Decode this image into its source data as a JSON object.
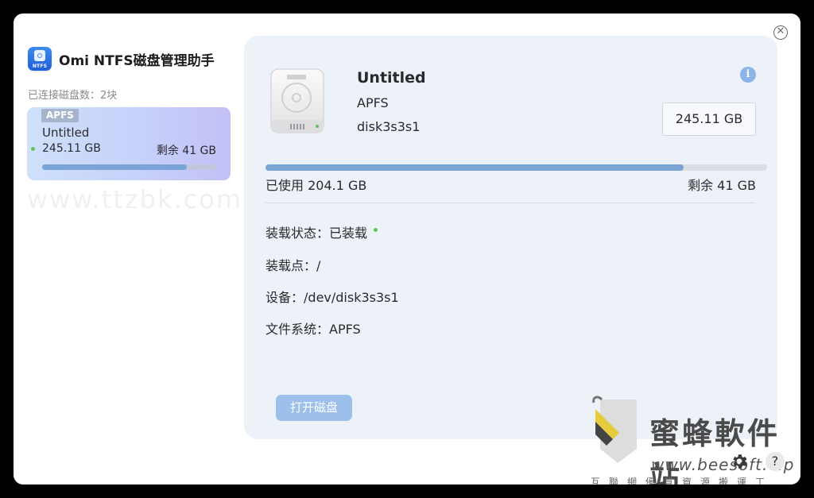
{
  "app": {
    "title": "Omi NTFS磁盘管理助手",
    "logo_text": "NTFS"
  },
  "sidebar": {
    "disk_count_label": "已连接磁盘数：2块",
    "disks": [
      {
        "fs_tag": "APFS",
        "name": "Untitled",
        "size": "245.11 GB",
        "free": "剩余 41 GB",
        "used_fraction": 0.833,
        "status_color": "#5dc65b"
      }
    ],
    "watermark": "www.ttzbk.com"
  },
  "detail": {
    "name": "Untitled",
    "fs": "APFS",
    "device_id": "disk3s3s1",
    "capacity": "245.11 GB",
    "used_label": "已使用 204.1 GB",
    "free_label": "剩余 41 GB",
    "used_fraction": 0.833,
    "properties": {
      "mount_status_label": "装载状态：",
      "mount_status_value": "已装载",
      "mount_point_label": "装载点：",
      "mount_point_value": "/",
      "device_label": "设备：",
      "device_value": "/dev/disk3s3s1",
      "filesystem_label": "文件系统：",
      "filesystem_value": "APFS"
    },
    "open_button": "打开磁盘"
  },
  "icons": {
    "close": "close-icon",
    "info": "info-icon",
    "settings": "gear-icon",
    "help": "help-icon",
    "help_glyph": "?"
  },
  "brand_watermark": {
    "title": "蜜蜂軟件站",
    "url": "www.beesoft.vip",
    "slogan": "互聯網優質資源搬運工"
  },
  "colors": {
    "accent": "#7aa4d4",
    "button": "#9dc0ea",
    "status_ok": "#5dc65b"
  }
}
